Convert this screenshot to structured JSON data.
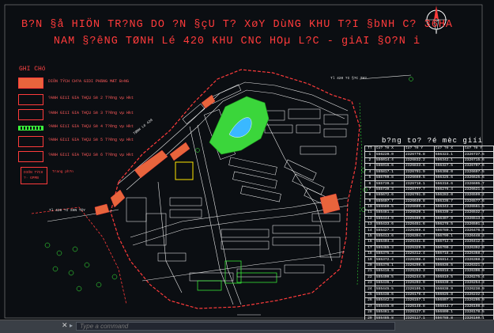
{
  "title": {
    "line1": "B?N §å HIÖN TR?NG DO ?N §çU T? XøY DùNG KHU T?I §bNH C? 36HA",
    "line2": "NAM §?êNG TØNH Lé 420 KHU CNC HOµ L?C - giAI §O?N i"
  },
  "legend": {
    "title": "GHI CHó",
    "items": [
      {
        "label": "DIÖN TÝCH CH?A GIDI PHãNG MÆT B»NG",
        "fill": "#e8643c"
      },
      {
        "label": "?ANH GIíI GIA THÇU Sè 2 T?êng vµ Hkt",
        "fill": "none"
      },
      {
        "label": "?ANH GIíI GIA THÇU Sè 3 T?êng vµ Hkt",
        "fill": "none"
      },
      {
        "label": "?ANH GIíI GIA THÇU Sè 4 T?êng vµ Hkt",
        "fill": "#3bff3b"
      },
      {
        "label": "?ANH GIíI GIA THÇU Sè 5 T?êng vµ Hkt",
        "fill": "none"
      },
      {
        "label": "?ANH GIíI GIA THÇU Sè 6 T?êng vµ Hkt",
        "fill": "none"
      }
    ],
    "box_text": "DIÖN TÝCH ?· GPMB",
    "box_side": "Trang ph?n"
  },
  "road_labels": {
    "north": "Tl 420 ?I §?C TH?",
    "west": "TØNH Lé 420",
    "south": "Tl 420 ?I S¥N T©Y"
  },
  "coord_table": {
    "title": "b?ng to? ?é mèc giíi",
    "header": [
      "TT",
      "to? ?é X",
      "to? ?é Y",
      "to? ?é X",
      "to? ?é Y"
    ],
    "rows": [
      [
        "1",
        "556220.0",
        "2326776.8",
        "556323.1",
        "2326737.5"
      ],
      [
        "2",
        "556014.4",
        "2326832.2",
        "556342.1",
        "2326715.6"
      ],
      [
        "3",
        "555916.6",
        "2326833.6",
        "556327.5",
        "2326707.6"
      ],
      [
        "4",
        "555817.1",
        "2326791.9",
        "556308.0",
        "2326697.5"
      ],
      [
        "5",
        "555799.8",
        "2326669.5",
        "556325.6",
        "2326625.6"
      ],
      [
        "6",
        "555739.8",
        "2326718.1",
        "556318.6",
        "2326605.7"
      ],
      [
        "7",
        "555739.3",
        "2326777.7",
        "556276.4",
        "2326621.6"
      ],
      [
        "8",
        "555672.6",
        "2326701.0",
        "556283.0",
        "2326599.2"
      ],
      [
        "9",
        "555607.7",
        "2326649.8",
        "556336.7",
        "2326577.6"
      ],
      [
        "10",
        "555580.5",
        "2326609.4",
        "556343.8",
        "2326561.5"
      ],
      [
        "11",
        "555481.3",
        "2326520.1",
        "556339.2",
        "2326532.7"
      ],
      [
        "12",
        "555444.9",
        "2326469.0",
        "556307.9",
        "2326513.5"
      ],
      [
        "13",
        "555433.6",
        "2326451.6",
        "556278.5",
        "2326501.1"
      ],
      [
        "14",
        "555427.3",
        "2326369.4",
        "556780.1",
        "2326476.4"
      ],
      [
        "15",
        "555413.6",
        "2326394.7",
        "556799.1",
        "2326448.3"
      ],
      [
        "16",
        "555404.3",
        "2326341.8",
        "556712.9",
        "2326412.5"
      ],
      [
        "17",
        "555385.3",
        "2326329.9",
        "556700.2",
        "2326392.0"
      ],
      [
        "18",
        "555375.3",
        "2326312.4",
        "556718.3",
        "2326368.7"
      ],
      [
        "19",
        "555372.4",
        "2326308.4",
        "556814.3",
        "2326368.2"
      ],
      [
        "20",
        "555376.1",
        "2326298.6",
        "556836.5",
        "2326321.7"
      ],
      [
        "21",
        "555416.9",
        "2326263.3",
        "556818.9",
        "2326306.0"
      ],
      [
        "22",
        "555409.5",
        "2326244.9",
        "556819.5",
        "2326275.4"
      ],
      [
        "23",
        "555436.7",
        "2326203.9",
        "556830.6",
        "2326254.3"
      ],
      [
        "24",
        "555445.5",
        "2326195.1",
        "556838.9",
        "2326238.9"
      ],
      [
        "25",
        "555438.6",
        "2326178.4",
        "556825.8",
        "2326232.1"
      ],
      [
        "26",
        "555442.3",
        "2326157.1",
        "556807.6",
        "2326205.9"
      ],
      [
        "27",
        "555445.0",
        "2326148.8",
        "556813.7",
        "2326198.8"
      ],
      [
        "28",
        "555461.0",
        "2326127.8",
        "556800.1",
        "2326178.5"
      ],
      [
        "29",
        "555485.8",
        "2326117.1",
        "556788.8",
        "2326160.1"
      ]
    ]
  },
  "command_line": {
    "placeholder": "Type a command",
    "prompt": "▸",
    "close_label": "✕"
  },
  "colors": {
    "background": "#0b0e12",
    "title": "#ff3b3b",
    "boundary": "#ff3b3b",
    "parcel": "#ffffff",
    "park": "#3bd63b",
    "water": "#3ab8ff",
    "road": "#e8e8e8",
    "orange_area": "#e8643c"
  }
}
